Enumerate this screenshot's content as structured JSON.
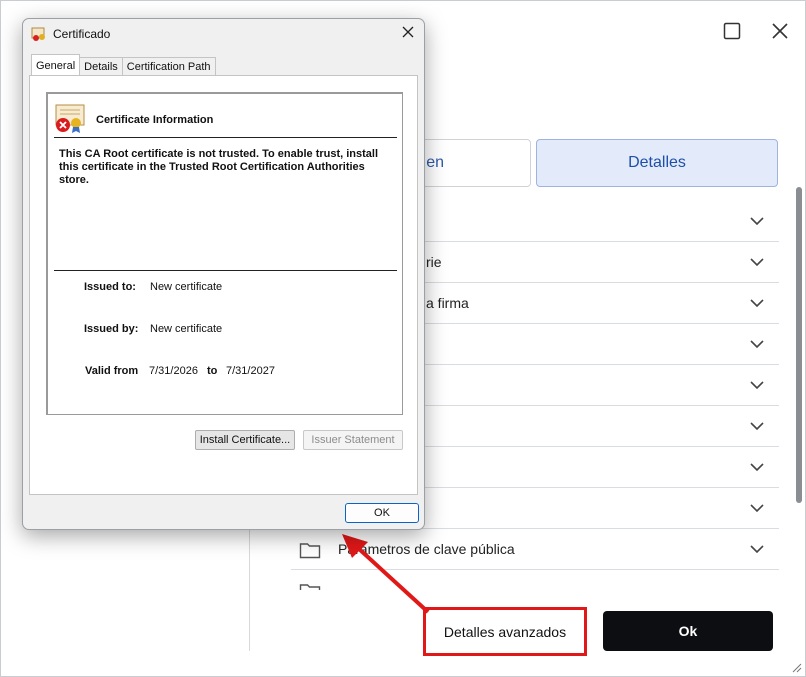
{
  "background_window": {
    "tabs": {
      "general_partial": "en",
      "details": "Detalles"
    },
    "rows": [
      {
        "label": ""
      },
      {
        "label": "rie"
      },
      {
        "label": "a firma"
      },
      {
        "label": ""
      },
      {
        "label": ""
      },
      {
        "label": ""
      },
      {
        "label": ""
      },
      {
        "label": ""
      },
      {
        "label": "Parámetros de clave pública"
      },
      {
        "label": ""
      }
    ],
    "buttons": {
      "advanced": "Detalles avanzados",
      "ok": "Ok"
    },
    "colors": {
      "highlight": "#e01818",
      "primary": "#0c0e12",
      "accent": "#1e4fa8"
    }
  },
  "dialog": {
    "title": "Certificado",
    "tabs": [
      "General",
      "Details",
      "Certification Path"
    ],
    "info_title": "Certificate Information",
    "warning": "This CA Root certificate is not trusted. To enable trust, install this certificate in the Trusted Root Certification Authorities store.",
    "issued_to_label": "Issued to:",
    "issued_to": "New certificate",
    "issued_by_label": "Issued by:",
    "issued_by": "New certificate",
    "valid_from_label": "Valid from",
    "valid_from": "7/31/2026",
    "valid_to_label": "to",
    "valid_to": "7/31/2027",
    "install_button": "Install Certificate...",
    "issuer_statement_button": "Issuer Statement",
    "ok_button": "OK"
  }
}
